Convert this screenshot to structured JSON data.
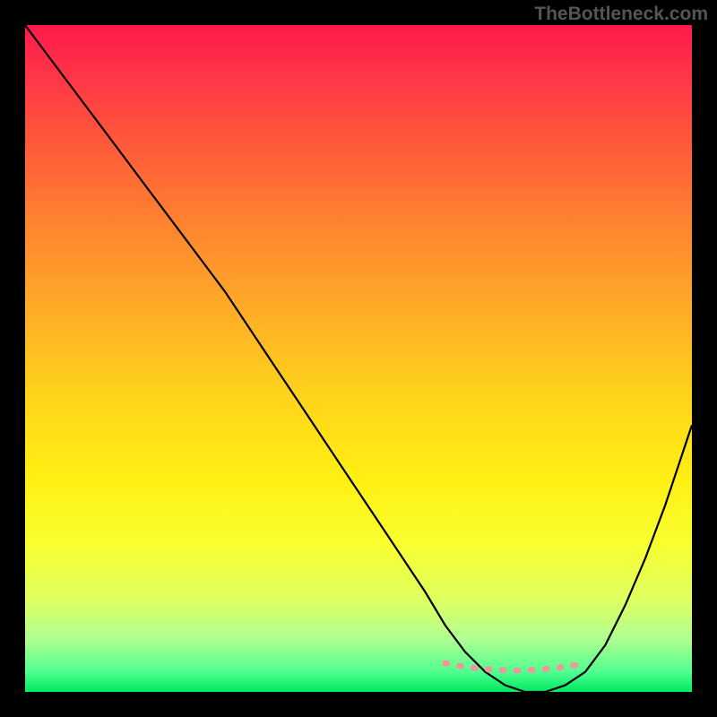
{
  "watermark": "TheBottleneck.com",
  "chart_data": {
    "type": "line",
    "title": "",
    "xlabel": "",
    "ylabel": "",
    "xlim": [
      0,
      100
    ],
    "ylim": [
      0,
      100
    ],
    "series": [
      {
        "name": "curve",
        "x": [
          0,
          6,
          12,
          18,
          24,
          30,
          36,
          42,
          48,
          54,
          60,
          63,
          66,
          69,
          72,
          75,
          78,
          81,
          84,
          87,
          90,
          93,
          96,
          100
        ],
        "values": [
          100,
          92,
          84,
          76,
          68,
          60,
          51,
          42,
          33,
          24,
          15,
          10,
          6,
          3,
          1,
          0,
          0,
          1,
          3,
          7,
          13,
          20,
          28,
          40
        ]
      }
    ],
    "annotations": [
      {
        "name": "flat-region-marker",
        "x_start": 63,
        "x_end": 84,
        "y": 3.5,
        "style": "dotted",
        "color": "#ee9999"
      }
    ],
    "colors": {
      "curve": "#000000",
      "marker": "#ee9999",
      "background_top": "#ff1a4a",
      "background_bottom": "#00e860",
      "frame": "#000000"
    }
  }
}
